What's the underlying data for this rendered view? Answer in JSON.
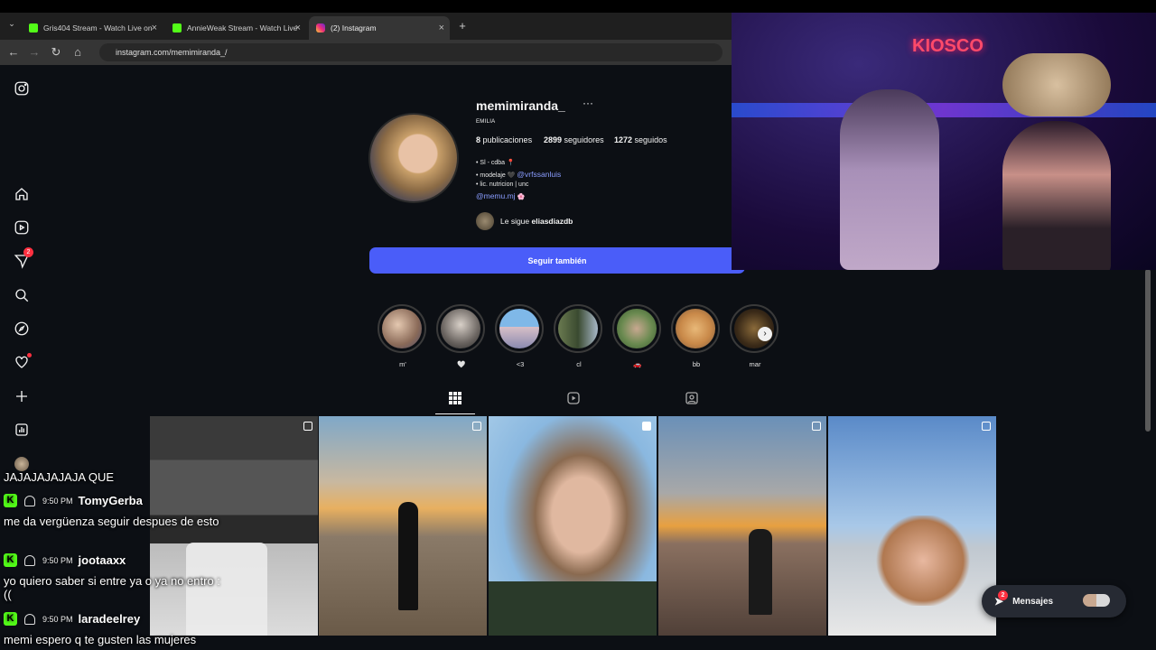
{
  "browser": {
    "tabs": [
      {
        "title": "Gris404 Stream - Watch Live on"
      },
      {
        "title": "AnnieWeak Stream - Watch Live"
      },
      {
        "title": "(2) Instagram"
      }
    ],
    "new_tab": "+",
    "url": "instagram.com/memimiranda_/"
  },
  "sidebar": {
    "notification_count": "2"
  },
  "profile": {
    "username": "memimiranda_",
    "more": "···",
    "full_name": "EMILIA",
    "posts_count": "8",
    "posts_label": "publicaciones",
    "followers_count": "2899",
    "followers_label": "seguidores",
    "following_count": "1272",
    "following_label": "seguidos",
    "bio": [
      {
        "text": "• Sl - cdba 📍"
      },
      {
        "text": "• modelaje 🖤",
        "link": "@vrfssanluis"
      },
      {
        "text": "• lic. nutricion | unc"
      },
      {
        "link": "@memu.mj",
        "text": "🌸"
      }
    ],
    "followed_by_prefix": "Le sigue",
    "followed_by_user": "eliasdiazdb",
    "follow_button": "Seguir también"
  },
  "highlights": [
    {
      "label": "m'"
    },
    {
      "label": "🤍"
    },
    {
      "label": "<3"
    },
    {
      "label": "cl"
    },
    {
      "label": "🚗"
    },
    {
      "label": "bb"
    },
    {
      "label": "mar"
    }
  ],
  "profile_tabs": [
    {
      "icon": "grid-icon"
    },
    {
      "icon": "reels-icon"
    },
    {
      "icon": "tagged-icon"
    }
  ],
  "messages": {
    "label": "Mensajes",
    "badge": "2"
  },
  "chat": [
    {
      "text": "JAJAJAJAJAJA QUE"
    },
    {
      "time": "9:50 PM",
      "user": "TomyGerba",
      "text": "me da vergüenza seguir despues de esto"
    },
    {
      "time": "9:50 PM",
      "user": "jootaaxx",
      "text": "yo quiero saber si entre ya o ya no entro :(("
    },
    {
      "time": "9:50 PM",
      "user": "laradeelrey",
      "text": "memi espero q te gusten las mujeres"
    }
  ],
  "webcam": {
    "sign": "KIOSCO"
  },
  "colors": {
    "follow_button": "#4a5df9",
    "kick_green": "#53fc18",
    "notif_red": "#ff3040"
  }
}
